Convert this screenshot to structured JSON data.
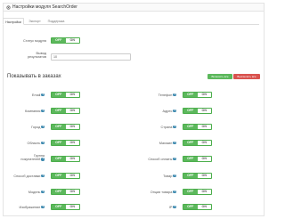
{
  "header": {
    "title": "Настройки модуля SearchOrder",
    "icon": "gear-icon"
  },
  "tabs": [
    {
      "label": "Настройки"
    },
    {
      "label": "Экспорт"
    },
    {
      "label": "Поддержка"
    }
  ],
  "switch": {
    "off": "OFF",
    "on": "ON"
  },
  "status": {
    "label": "Статус модуля"
  },
  "results": {
    "label_line1": "Вывод",
    "label_line2": "результатов",
    "value": "10"
  },
  "section_title": "Показывать в заказах",
  "buttons": {
    "select_all": "Включить все",
    "deselect_all": "Выключить все"
  },
  "fields_left": [
    {
      "label": "Email"
    },
    {
      "label": "Компания"
    },
    {
      "label": "Город"
    },
    {
      "label": "Область"
    },
    {
      "label": "Группа",
      "label2": "покупателей"
    },
    {
      "label": "Способ доставки"
    },
    {
      "label": "Модель"
    },
    {
      "label": "Изображение"
    }
  ],
  "fields_right": [
    {
      "label": "Телефон"
    },
    {
      "label": "Адрес"
    },
    {
      "label": "Страна"
    },
    {
      "label": "Магазин"
    },
    {
      "label": "Способ оплаты"
    },
    {
      "label": "Товар"
    },
    {
      "label": "Опции товара"
    },
    {
      "label": "IP"
    }
  ],
  "colors": {
    "switch_green": "#5cb85c",
    "btn_green": "#5cb85c",
    "btn_red": "#d9534f",
    "help": "#3a87ad"
  }
}
